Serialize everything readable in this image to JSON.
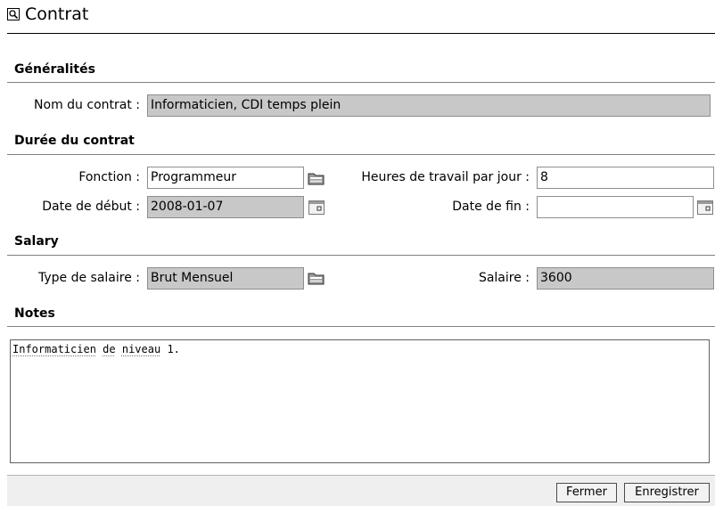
{
  "window": {
    "title": "Contrat",
    "title_icon": "magnifier-icon"
  },
  "sections": {
    "general": "Généralités",
    "duration": "Durée du contrat",
    "salary": "Salary",
    "notes": "Notes"
  },
  "general": {
    "contract_name_label": "Nom du contrat :",
    "contract_name_value": "Informaticien, CDI temps plein"
  },
  "duration": {
    "function_label": "Fonction :",
    "function_value": "Programmeur",
    "hours_label": "Heures de travail par jour :",
    "hours_value": "8",
    "start_label": "Date de début :",
    "start_value": "2008-01-07",
    "end_label": "Date de fin :",
    "end_value": ""
  },
  "salary": {
    "type_label": "Type de salaire :",
    "type_value": "Brut Mensuel",
    "amount_label": "Salaire :",
    "amount_value": "3600"
  },
  "notes": {
    "text": "Informaticien de niveau 1.",
    "words": [
      "Informaticien",
      "de",
      "niveau",
      "1."
    ]
  },
  "footer": {
    "close_label": "Fermer",
    "save_label": "Enregistrer"
  },
  "colors": {
    "readonly_bg": "#c8c8c8",
    "footer_bg": "#efefef"
  }
}
